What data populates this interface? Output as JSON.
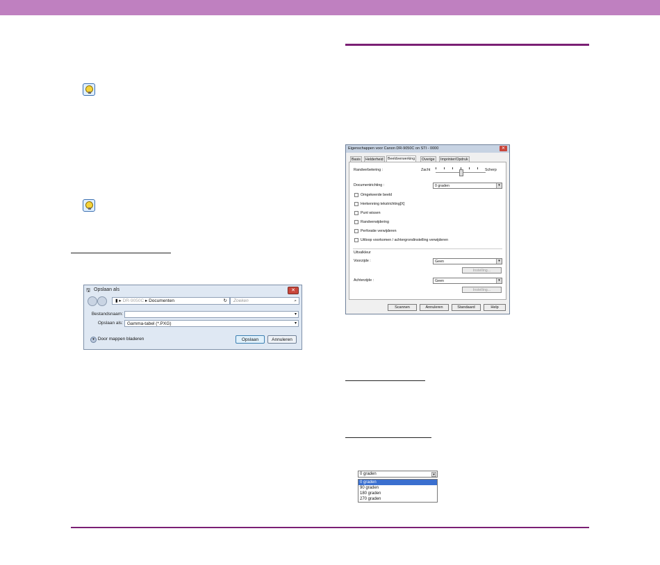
{
  "save_dialog": {
    "title": "Opslaan als",
    "close": "✕",
    "address_prefix": "DR-9050C",
    "address_sep": "▸",
    "address_folder": "Documenten",
    "search_placeholder": "Zoeken",
    "filename_label": "Bestandsnaam:",
    "filename_value": "",
    "saveas_label": "Opslaan als:",
    "saveas_value": "Gamma-tabel (*.PXG)",
    "browse_label": "Door mappen bladeren",
    "save_button": "Opslaan",
    "cancel_button": "Annuleren"
  },
  "properties_dialog": {
    "title": "Eigenschappen voor Canon DR-9050C on STI - 0000",
    "close": "✕",
    "tabs": [
      "Basis",
      "Helderheid",
      "Beeldverwerking",
      "Overige",
      "Imprinter/Opdruk"
    ],
    "edge_label": "Randverbetering :",
    "edge_low": "Zacht",
    "edge_high": "Scherp",
    "edge_level": 0.5,
    "orientation_label": "Documentrichting :",
    "orientation_value": "0 graden",
    "checkboxes": [
      "Omgekeerde beeld",
      "Herkenning tekstrichting[X]",
      "Punt wissen",
      "Randverwijdering",
      "Perforatie verwijderen",
      "Uitloop voorkomen / achtergrondinstelling verwijderen"
    ],
    "dropout_heading": "Uitvalkleur",
    "front_label": "Voorzijde :",
    "front_value": "Geen",
    "front_setting": "Instelling...",
    "back_label": "Achterzijde :",
    "back_value": "Geen",
    "back_setting": "Instelling...",
    "buttons": [
      "Scannen",
      "Annuleren",
      "Standaard",
      "Help"
    ]
  },
  "rotation_dropdown": {
    "selected": "0 graden",
    "options": [
      "0 graden",
      "90 graden",
      "180 graden",
      "270 graden"
    ],
    "highlighted_index": 0
  },
  "colors": {
    "header_bar": "#bf80c0",
    "rule": "#7a1f74"
  }
}
